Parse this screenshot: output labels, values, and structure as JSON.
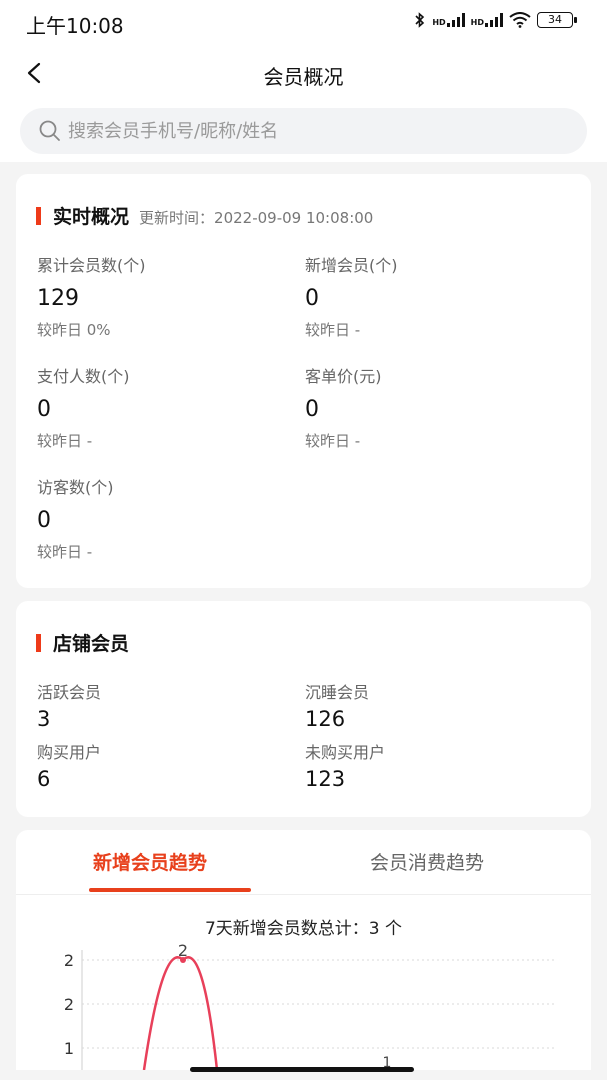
{
  "status": {
    "time": "上午10:08",
    "battery": "34",
    "hd": "HD"
  },
  "nav": {
    "title": "会员概况"
  },
  "search": {
    "placeholder": "搜索会员手机号/昵称/姓名"
  },
  "realtime": {
    "title": "实时概况",
    "update_label": "更新时间：",
    "update_time": "2022-09-09 10:08:00",
    "metrics": [
      {
        "label": "累计会员数(个)",
        "value": "129",
        "compare": "较昨日 0%"
      },
      {
        "label": "新增会员(个)",
        "value": "0",
        "compare": "较昨日 -"
      },
      {
        "label": "支付人数(个)",
        "value": "0",
        "compare": "较昨日 -"
      },
      {
        "label": "客单价(元)",
        "value": "0",
        "compare": "较昨日 -"
      },
      {
        "label": "访客数(个)",
        "value": "0",
        "compare": "较昨日 -"
      }
    ]
  },
  "store": {
    "title": "店铺会员",
    "metrics": [
      {
        "label": "活跃会员",
        "value": "3"
      },
      {
        "label": "沉睡会员",
        "value": "126"
      },
      {
        "label": "购买用户",
        "value": "6"
      },
      {
        "label": "未购买用户",
        "value": "123"
      }
    ]
  },
  "trend": {
    "tabs": [
      {
        "label": "新增会员趋势"
      },
      {
        "label": "会员消费趋势"
      }
    ],
    "total_text": "7天新增会员数总计：3 个"
  },
  "colors": {
    "accent": "#e8401c",
    "line": "#e8405a"
  },
  "chart_data": {
    "type": "line",
    "y_tick_labels": [
      "2",
      "2",
      "1"
    ],
    "points": [
      {
        "index": 1,
        "value": 2,
        "label": "2"
      },
      {
        "index": 4,
        "value": 1,
        "label": "1"
      }
    ],
    "grid": "horizontal-dotted"
  }
}
